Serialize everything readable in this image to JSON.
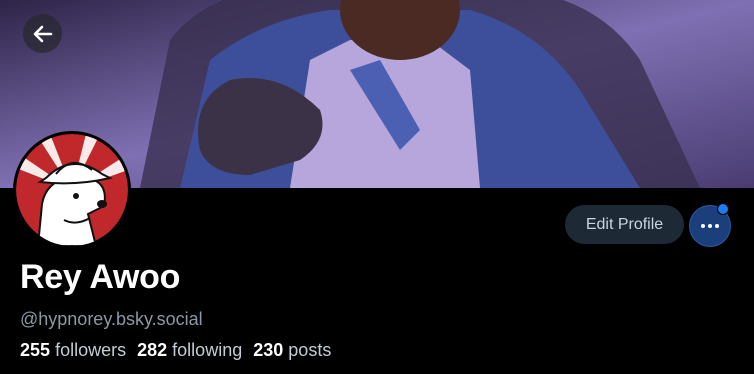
{
  "profile": {
    "name": "Rey Awoo",
    "handle": "@hypnorey.bsky.social",
    "followers_count": "255",
    "followers_label": "followers",
    "following_count": "282",
    "following_label": "following",
    "posts_count": "230",
    "posts_label": "posts"
  },
  "actions": {
    "edit_label": "Edit Profile",
    "back_icon": "arrow-left-icon",
    "more_icon": "ellipsis-icon"
  },
  "colors": {
    "background": "#000000",
    "edit_button_bg": "#1e2936",
    "more_button_bg": "#1a3f7a",
    "notification_dot": "#1d7cf2",
    "handle_text": "#8c98a6"
  }
}
